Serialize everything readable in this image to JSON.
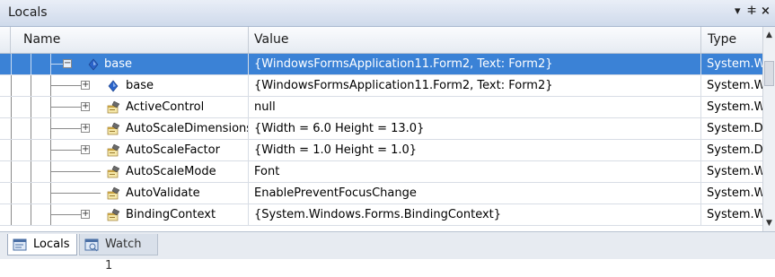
{
  "window": {
    "title": "Locals",
    "pin_glyph": "▾ ⊥",
    "close_glyph": "×"
  },
  "columns": {
    "name": "Name",
    "value": "Value",
    "type": "Type"
  },
  "rows": [
    {
      "name": "base",
      "value": "{WindowsFormsApplication11.Form2, Text: Form2}",
      "type": "System.W",
      "icon": "field-icon",
      "expander": "−",
      "selected": true
    },
    {
      "name": "base",
      "value": "{WindowsFormsApplication11.Form2, Text: Form2}",
      "type": "System.W",
      "icon": "field-icon",
      "expander": "+"
    },
    {
      "name": "ActiveControl",
      "value": "null",
      "type": "System.W",
      "icon": "property-icon",
      "expander": "+"
    },
    {
      "name": "AutoScaleDimensions",
      "value": "{Width = 6.0 Height = 13.0}",
      "type": "System.D",
      "icon": "property-icon",
      "expander": "+"
    },
    {
      "name": "AutoScaleFactor",
      "value": "{Width = 1.0 Height = 1.0}",
      "type": "System.D",
      "icon": "property-icon",
      "expander": "+"
    },
    {
      "name": "AutoScaleMode",
      "value": "Font",
      "type": "System.W",
      "icon": "property-icon",
      "expander": ""
    },
    {
      "name": "AutoValidate",
      "value": "EnablePreventFocusChange",
      "type": "System.W",
      "icon": "property-icon",
      "expander": ""
    },
    {
      "name": "BindingContext",
      "value": "{System.Windows.Forms.BindingContext}",
      "type": "System.W",
      "icon": "property-icon",
      "expander": "+"
    }
  ],
  "tabs": [
    {
      "label": "Locals",
      "icon": "locals-icon",
      "active": true
    },
    {
      "label": "Watch 1",
      "icon": "watch-icon",
      "active": false
    }
  ],
  "colors": {
    "selection": "#3b82d6",
    "header": "#e6ebf2",
    "tabbar": "#e7ebf1"
  }
}
